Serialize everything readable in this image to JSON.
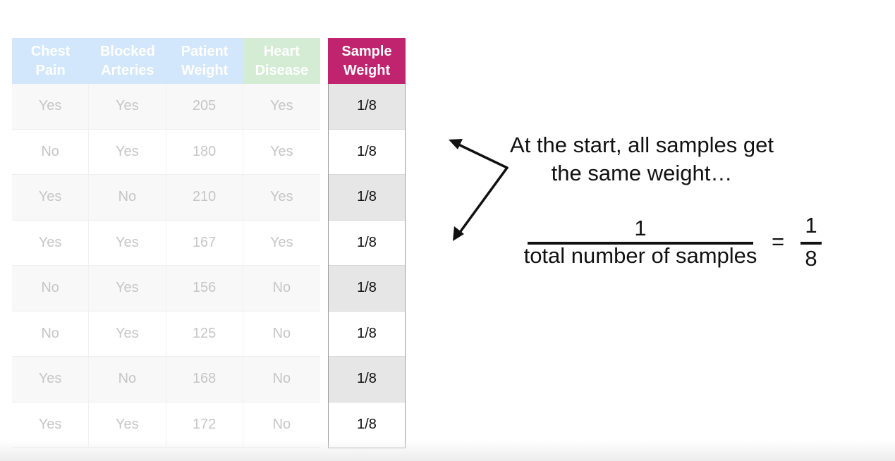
{
  "table": {
    "headers": [
      "Chest\nPain",
      "Blocked\nArteries",
      "Patient\nWeight",
      "Heart\nDisease"
    ],
    "rows": [
      [
        "Yes",
        "Yes",
        "205",
        "Yes"
      ],
      [
        "No",
        "Yes",
        "180",
        "Yes"
      ],
      [
        "Yes",
        "No",
        "210",
        "Yes"
      ],
      [
        "Yes",
        "Yes",
        "167",
        "Yes"
      ],
      [
        "No",
        "Yes",
        "156",
        "No"
      ],
      [
        "No",
        "Yes",
        "125",
        "No"
      ],
      [
        "Yes",
        "No",
        "168",
        "No"
      ],
      [
        "Yes",
        "Yes",
        "172",
        "No"
      ]
    ]
  },
  "weights": {
    "header": "Sample\nWeight",
    "values": [
      "1/8",
      "1/8",
      "1/8",
      "1/8",
      "1/8",
      "1/8",
      "1/8",
      "1/8"
    ]
  },
  "annotation": {
    "line1": "At the start, all samples get",
    "line2": "the same weight…"
  },
  "formula": {
    "numerator": "1",
    "denominator": "total number of samples",
    "equals": "=",
    "result_numerator": "1",
    "result_denominator": "8"
  },
  "colors": {
    "feature_header": "#d2e7fb",
    "target_header": "#d5ecd4",
    "weight_header": "#c0246e",
    "faded_text": "#c6c6c6"
  }
}
